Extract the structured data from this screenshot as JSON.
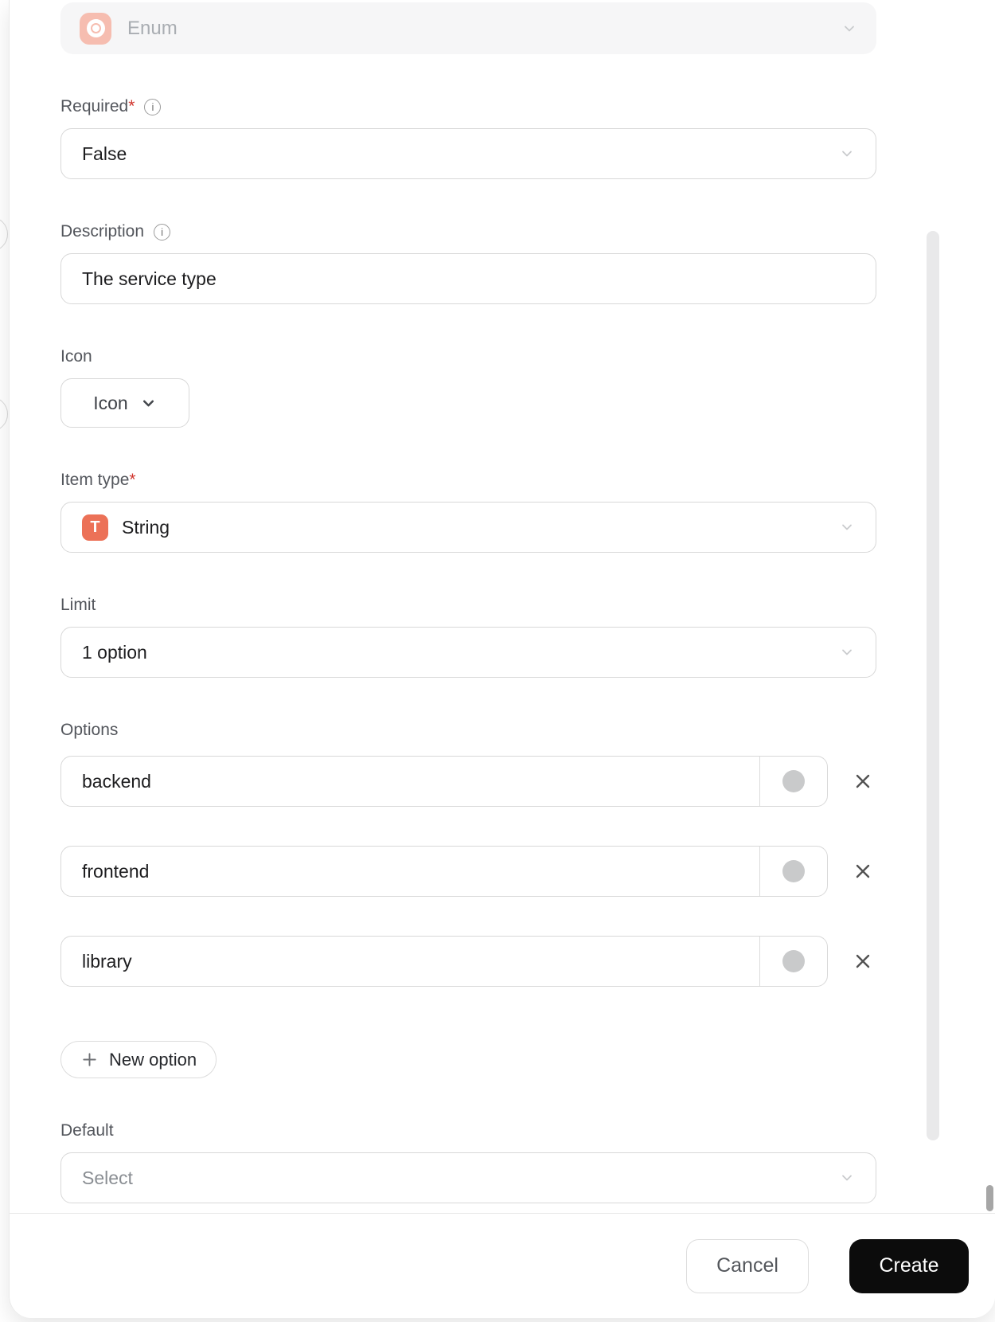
{
  "dialog": {
    "type_field": {
      "value": "Enum"
    },
    "required": {
      "label": "Required",
      "star": "*",
      "info": "i",
      "value": "False"
    },
    "description": {
      "label": "Description",
      "info": "i",
      "value": "The service type"
    },
    "icon": {
      "label": "Icon",
      "button": "Icon"
    },
    "item_type": {
      "label": "Item type",
      "star": "*",
      "badge": "T",
      "value": "String"
    },
    "limit": {
      "label": "Limit",
      "value": "1 option"
    },
    "options": {
      "label": "Options",
      "items": [
        "backend",
        "frontend",
        "library"
      ],
      "new_option_label": "New option"
    },
    "default": {
      "label": "Default",
      "placeholder": "Select"
    },
    "footer": {
      "cancel": "Cancel",
      "create": "Create"
    }
  },
  "colors": {
    "accent_coral": "#ec7157",
    "accent_coral_light": "#f6bdb0",
    "swatch_gray": "#c9cacb",
    "create_button_bg": "#0c0c0c",
    "danger_star": "#d0342c"
  },
  "icons": {
    "enum_badge": "enum-record-icon",
    "string_badge": "letter-t-icon",
    "dropdown": "chevron-down-icon",
    "remove": "close-icon",
    "add": "plus-icon",
    "help": "info-icon"
  }
}
